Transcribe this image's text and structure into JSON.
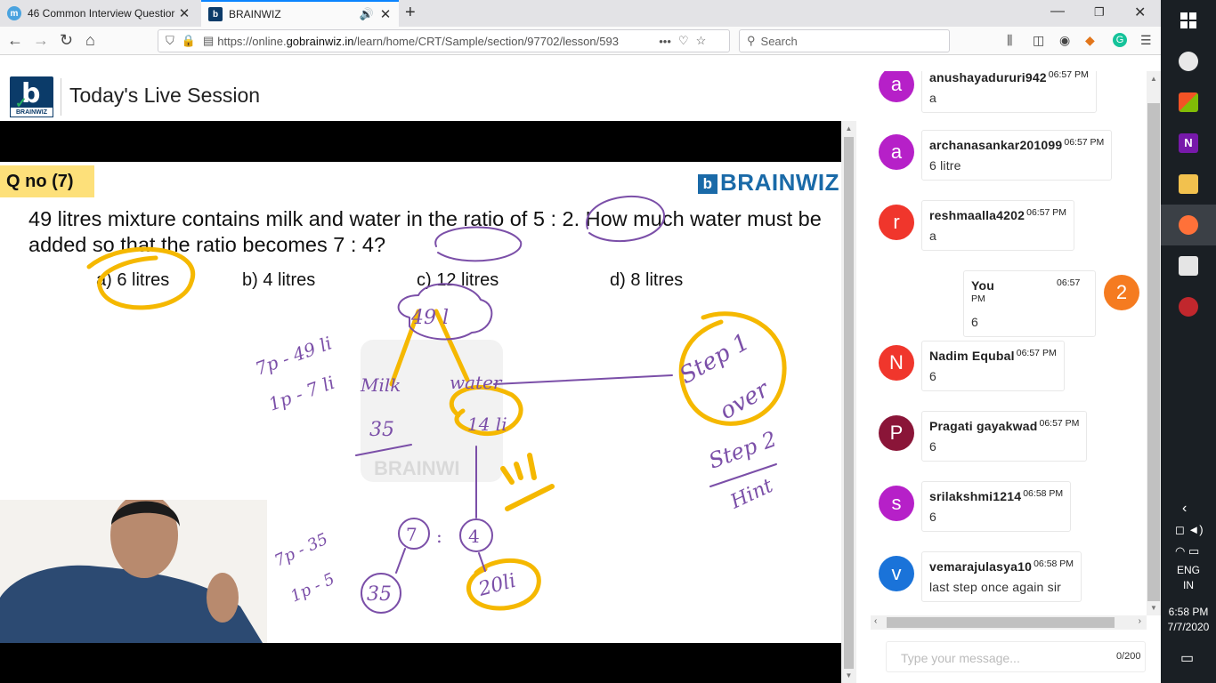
{
  "browser": {
    "tabs": [
      {
        "title": "46 Common Interview Questior",
        "icon": "m-icon",
        "active": false
      },
      {
        "title": "BRAINWIZ",
        "icon": "brainwiz-icon",
        "active": true
      }
    ],
    "url_prefix": "https://online.",
    "url_domain": "gobrainwiz.in",
    "url_path": "/learn/home/CRT/Sample/section/97702/lesson/593",
    "search_placeholder": "Search"
  },
  "page": {
    "logo_text": "BRAINWIZ",
    "title": "Today's Live Session"
  },
  "slide": {
    "qno": "Q no (7)",
    "brand": "BRAINWIZ",
    "question": "49 litres mixture contains milk and water in the ratio of 5 : 2. How much water must be added so that the ratio becomes 7 : 4?",
    "options": [
      "a) 6 litres",
      "b) 4 litres",
      "c) 12 litres",
      "d) 8 litres"
    ]
  },
  "chat": {
    "messages": [
      {
        "user": "anushayadururi942",
        "time": "06:57 PM",
        "text": "a",
        "initial": "a",
        "color": "#b620c8"
      },
      {
        "user": "archanasankar201099",
        "time": "06:57 PM",
        "text": "6 litre",
        "initial": "a",
        "color": "#b620c8"
      },
      {
        "user": "reshmaalla4202",
        "time": "06:57 PM",
        "text": "a",
        "initial": "r",
        "color": "#f0362c"
      },
      {
        "user": "You",
        "time": "06:57 PM",
        "text": "6",
        "initial": "2",
        "color": "#f57b20"
      },
      {
        "user": "Nadim Equbal",
        "time": "06:57 PM",
        "text": "6",
        "initial": "N",
        "color": "#f0362c"
      },
      {
        "user": "Pragati gayakwad",
        "time": "06:57 PM",
        "text": "6",
        "initial": "P",
        "color": "#8a1538"
      },
      {
        "user": "srilakshmi1214",
        "time": "06:58 PM",
        "text": "6",
        "initial": "s",
        "color": "#b620c8"
      },
      {
        "user": "vemarajulasya10",
        "time": "06:58 PM",
        "text": "last step once again sir",
        "initial": "v",
        "color": "#1a73d9"
      }
    ],
    "input_placeholder": "Type your message...",
    "char_count": "0/200"
  },
  "taskbar": {
    "lang_line1": "ENG",
    "lang_line2": "IN",
    "time": "6:58 PM",
    "date": "7/7/2020"
  }
}
